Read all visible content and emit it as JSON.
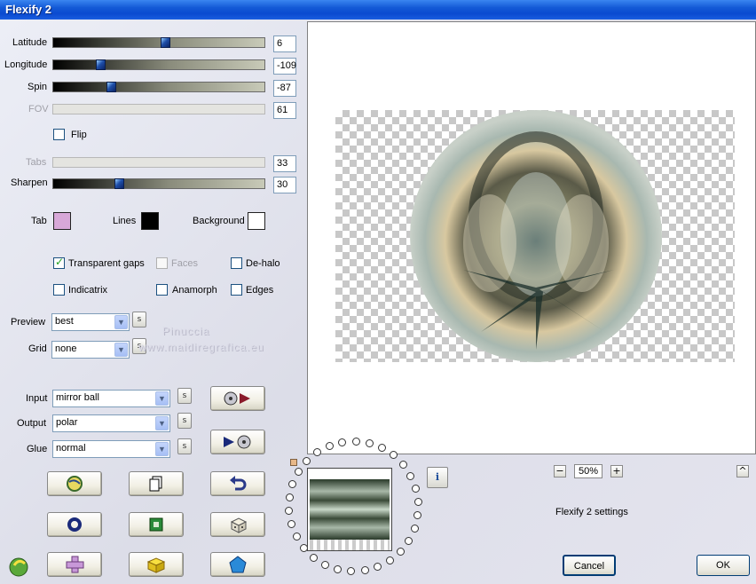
{
  "window": {
    "title": "Flexify 2"
  },
  "sliders": [
    {
      "key": "latitude",
      "label": "Latitude",
      "value": "6",
      "level": 0.53,
      "enabled": true
    },
    {
      "key": "longitude",
      "label": "Longitude",
      "value": "-109",
      "level": 0.21,
      "enabled": true
    },
    {
      "key": "spin",
      "label": "Spin",
      "value": "-87",
      "level": 0.26,
      "enabled": true
    },
    {
      "key": "fov",
      "label": "FOV",
      "value": "61",
      "level": null,
      "enabled": false
    },
    {
      "key": "tabs",
      "label": "Tabs",
      "value": "33",
      "level": null,
      "enabled": false
    },
    {
      "key": "sharpen",
      "label": "Sharpen",
      "value": "30",
      "level": 0.3,
      "enabled": true
    }
  ],
  "flip": {
    "label": "Flip",
    "checked": false
  },
  "colors": {
    "tab_label": "Tab",
    "tab_color": "#d8a8d8",
    "lines_label": "Lines",
    "lines_color": "#000000",
    "background_label": "Background",
    "background_color": "#ffffff"
  },
  "options": {
    "transparent_gaps": {
      "label": "Transparent gaps",
      "checked": true
    },
    "faces": {
      "label": "Faces",
      "checked": false,
      "enabled": false
    },
    "de_halo": {
      "label": "De-halo",
      "checked": false
    },
    "indicatrix": {
      "label": "Indicatrix",
      "checked": false
    },
    "anamorph": {
      "label": "Anamorph",
      "checked": false
    },
    "edges": {
      "label": "Edges",
      "checked": false
    }
  },
  "preview_select": {
    "label": "Preview",
    "value": "best"
  },
  "grid_select": {
    "label": "Grid",
    "value": "none"
  },
  "input_select": {
    "label": "Input",
    "value": "mirror ball"
  },
  "output_select": {
    "label": "Output",
    "value": "polar"
  },
  "glue_select": {
    "label": "Glue",
    "value": "normal"
  },
  "s_button_label": "s",
  "watermark": {
    "line1": "Pinuccia",
    "line2": "www.maidiregrafica.eu"
  },
  "zoom": {
    "minus": "−",
    "value": "50%",
    "plus": "+"
  },
  "settings_text": "Flexify 2 settings",
  "info_label": "i",
  "buttons": {
    "cancel": "Cancel",
    "ok": "OK",
    "scroll_up": "^"
  }
}
